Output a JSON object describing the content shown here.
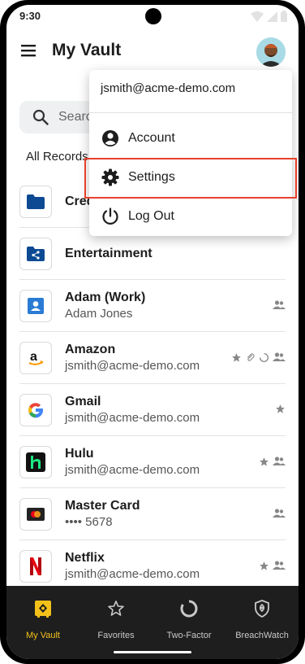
{
  "status": {
    "time": "9:30"
  },
  "header": {
    "title": "My Vault"
  },
  "search": {
    "placeholder": "Search"
  },
  "filter": {
    "label": "All Records"
  },
  "records": [
    {
      "title": "Credit Cards",
      "subtitle": "",
      "icon": "folder-icon"
    },
    {
      "title": "Entertainment",
      "subtitle": "",
      "icon": "shared-folder-icon"
    },
    {
      "title": "Adam (Work)",
      "subtitle": "Adam Jones",
      "icon": "contact-card-icon",
      "badges": [
        "shared-icon"
      ]
    },
    {
      "title": "Amazon",
      "subtitle": "jsmith@acme-demo.com",
      "icon": "amazon-logo-icon",
      "badges": [
        "favorite-star-icon",
        "attachment-icon",
        "two-factor-icon",
        "shared-icon"
      ]
    },
    {
      "title": "Gmail",
      "subtitle": "jsmith@acme-demo.com",
      "icon": "google-logo-icon",
      "badges": [
        "favorite-star-icon"
      ]
    },
    {
      "title": "Hulu",
      "subtitle": "jsmith@acme-demo.com",
      "icon": "hulu-logo-icon",
      "badges": [
        "favorite-star-icon",
        "shared-icon"
      ]
    },
    {
      "title": "Master Card",
      "subtitle": "•••• 5678",
      "icon": "mastercard-logo-icon",
      "badges": [
        "shared-icon"
      ]
    },
    {
      "title": "Netflix",
      "subtitle": "jsmith@acme-demo.com",
      "icon": "netflix-logo-icon",
      "badges": [
        "favorite-star-icon",
        "shared-icon"
      ]
    }
  ],
  "account_menu": {
    "email": "jsmith@acme-demo.com",
    "items": [
      {
        "label": "Account",
        "icon": "account-circle-icon"
      },
      {
        "label": "Settings",
        "icon": "gear-icon",
        "highlighted": true
      },
      {
        "label": "Log Out",
        "icon": "power-icon"
      }
    ]
  },
  "bottom_nav": [
    {
      "label": "My Vault",
      "icon": "vault-icon",
      "active": true
    },
    {
      "label": "Favorites",
      "icon": "star-outline-icon",
      "active": false
    },
    {
      "label": "Two-Factor",
      "icon": "two-factor-timer-icon",
      "active": false
    },
    {
      "label": "BreachWatch",
      "icon": "breachwatch-shield-icon",
      "active": false
    }
  ],
  "colors": {
    "accent": "#f3c11a",
    "highlight_border": "#e8412c",
    "nav_background": "#1e1e1e",
    "folder_blue": "#0d4a93"
  }
}
